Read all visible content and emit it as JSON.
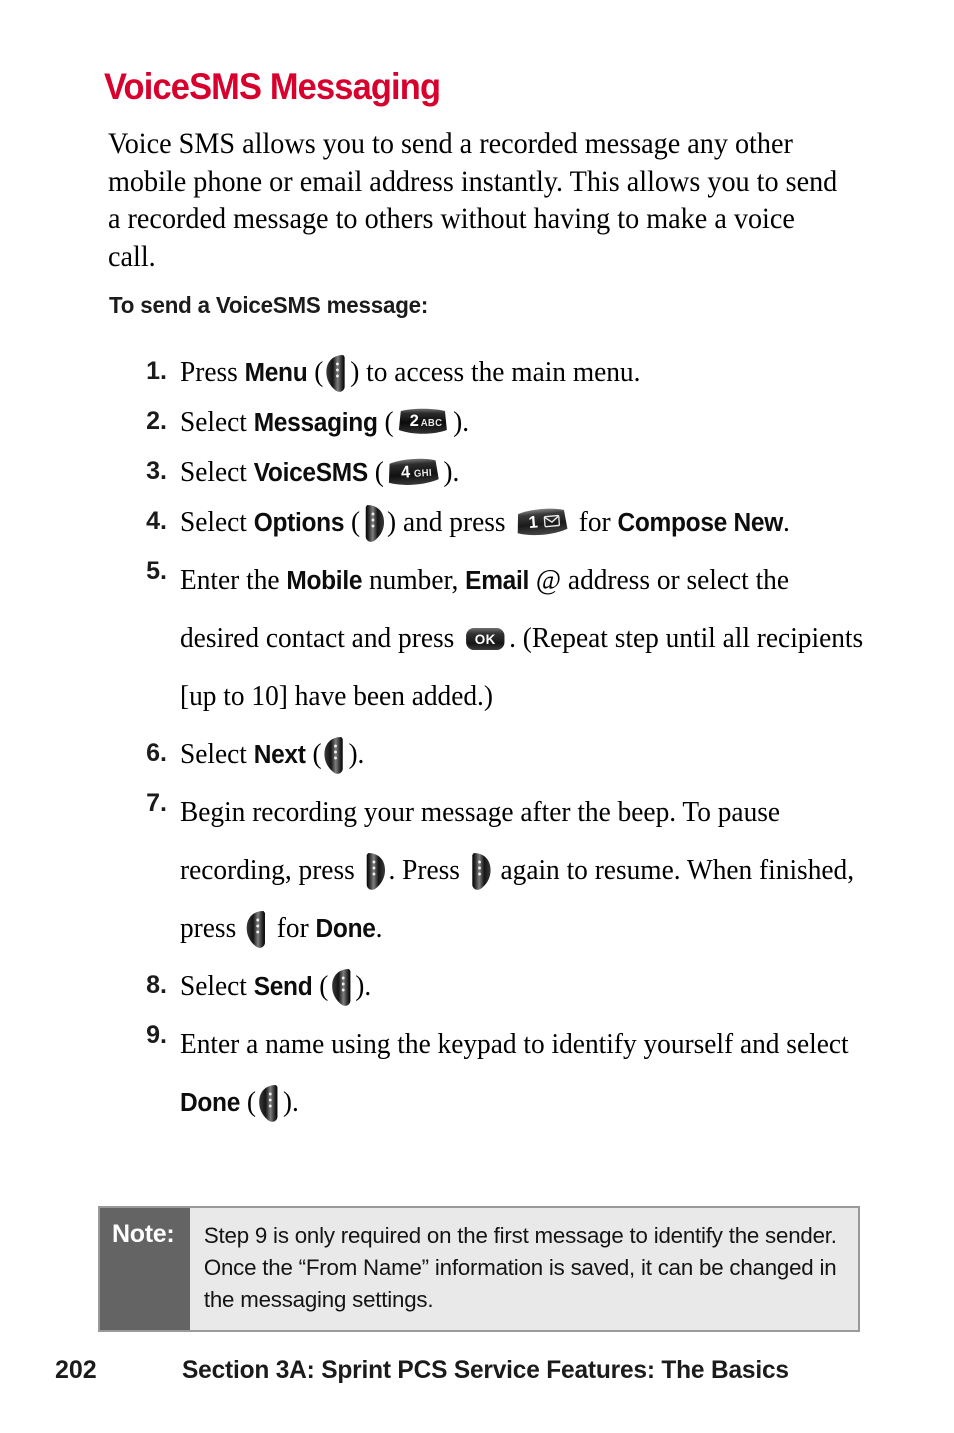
{
  "page": {
    "title": "VoiceSMS Messaging",
    "title_color": "#d8002c",
    "intro": "Voice SMS allows you to send a recorded message any other mobile phone or email address instantly. This allows you to send a recorded message to others without having to make a voice call.",
    "subheading": "To send a VoiceSMS message:"
  },
  "steps": [
    {
      "number": "1.",
      "pre": "Press ",
      "bold1": "Menu",
      "mid": " (",
      "icon": "softkey-left",
      "post": ") to access the main menu."
    },
    {
      "number": "2.",
      "pre": "Select ",
      "bold1": "Messaging",
      "mid": " (",
      "icon": "keypad-2-abc",
      "key_num": "2",
      "key_sub": "ABC",
      "post": ")."
    },
    {
      "number": "3.",
      "pre": "Select ",
      "bold1": "VoiceSMS",
      "mid": " (",
      "icon": "keypad-4-ghi",
      "key_num": "4",
      "key_sub": "GHI",
      "post": ")."
    },
    {
      "number": "4.",
      "pre": "Select ",
      "bold1": "Options",
      "mid": " (",
      "icon": "softkey-right",
      "post": ") and press ",
      "icon2": "keypad-1-envelope",
      "key2_num": "1",
      "key2_sub": "envelope-icon",
      "post2": " for ",
      "bold2": "Compose New",
      "post3": "."
    },
    {
      "number": "5.",
      "pre": "Enter the ",
      "bold1": "Mobile",
      "mid": " number, ",
      "bold2": "Email",
      "mid2": " @ address or select the desired contact and press ",
      "icon": "ok-key",
      "ok_label": "OK",
      "post": ". (Repeat step until all recipients [up to 10] have been added.)"
    },
    {
      "number": "6.",
      "pre": "Select ",
      "bold1": "Next",
      "mid": " (",
      "icon": "softkey-left",
      "post": ")."
    },
    {
      "number": "7.",
      "pre": "Begin recording your message after the beep. To pause recording, press ",
      "icon": "softkey-right",
      "mid": ". Press ",
      "icon2": "softkey-right",
      "mid2": " again to resume. When finished, press ",
      "icon3": "softkey-left",
      "post": " for ",
      "bold1": "Done",
      "post2": "."
    },
    {
      "number": "8.",
      "pre": "Select ",
      "bold1": "Send",
      "mid": " (",
      "icon": "softkey-left",
      "post": ")."
    },
    {
      "number": "9.",
      "pre": "Enter a name using the keypad to identify yourself and select ",
      "bold1": "Done",
      "mid": " (",
      "icon": "softkey-left",
      "post": ")."
    }
  ],
  "note": {
    "label": "Note:",
    "text": "Step 9 is only required on the first message to identify the sender. Once the “From Name” information is saved, it can be changed in the messaging settings.",
    "label_bg": "#646464",
    "body_bg": "#e9e9e9",
    "border": "#9a9a9a"
  },
  "footer": {
    "page_number": "202",
    "running_head": "Section 3A: Sprint PCS Service Features: The Basics"
  }
}
